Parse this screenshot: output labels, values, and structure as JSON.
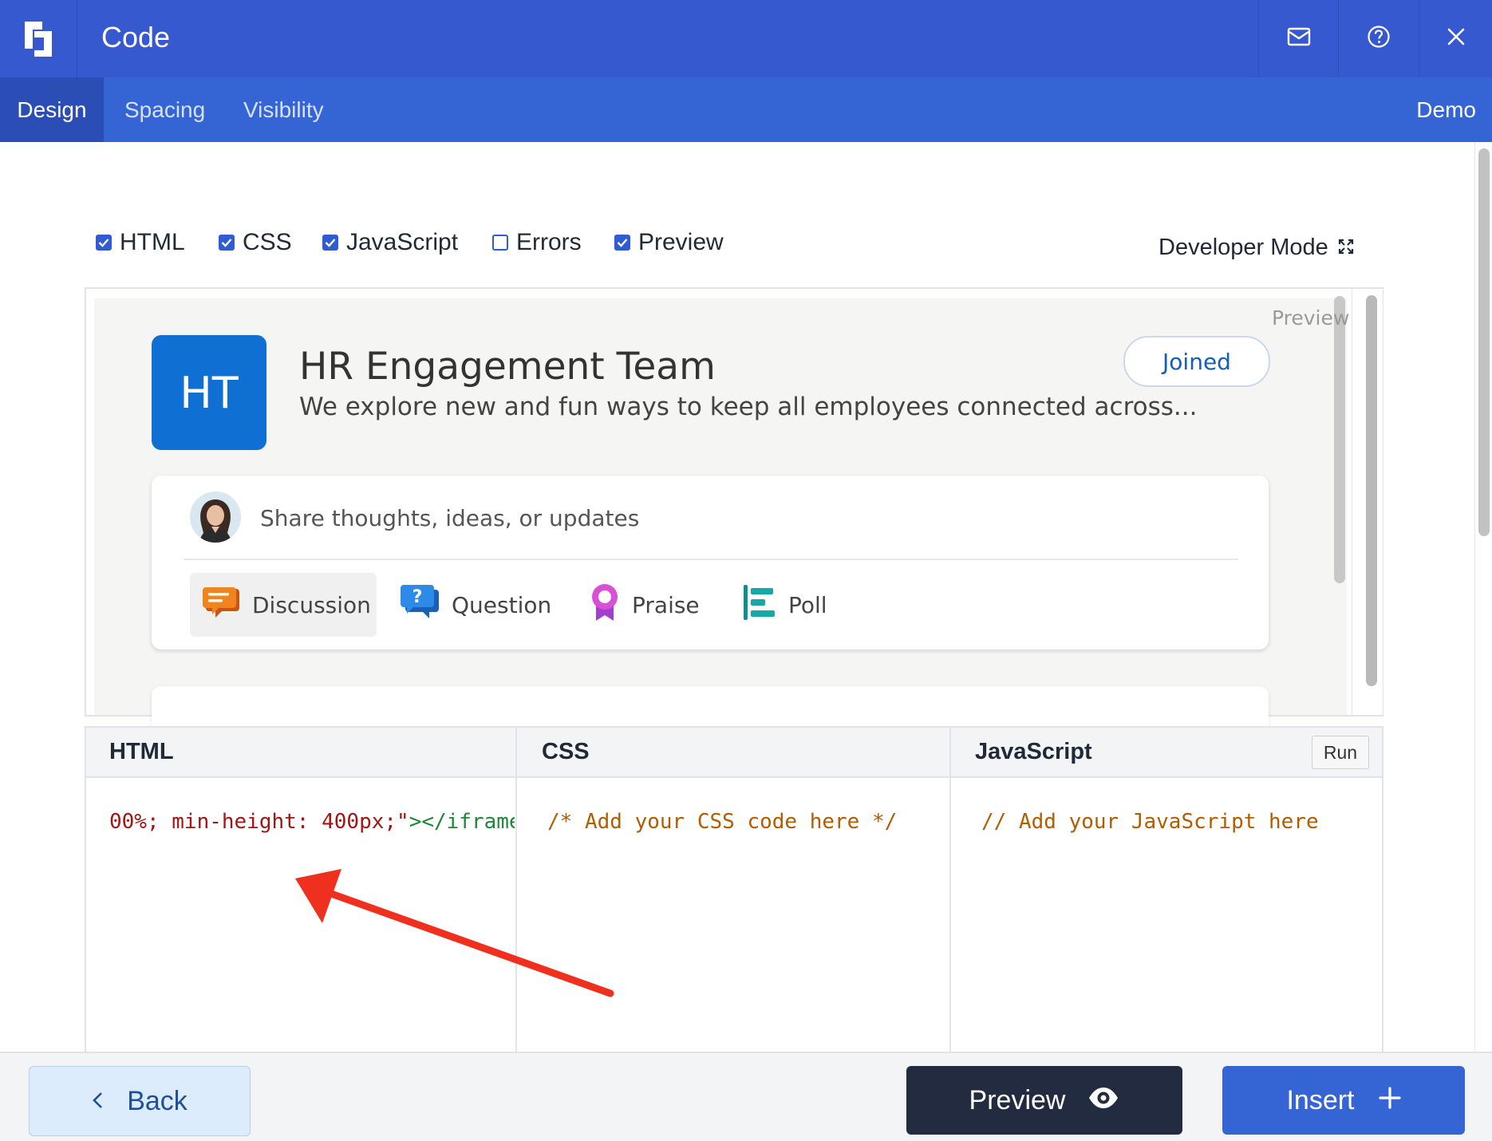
{
  "header": {
    "title": "Code",
    "logo_icon": "editor-logo-icon",
    "buttons": [
      {
        "icon": "mail-icon"
      },
      {
        "icon": "help-icon"
      },
      {
        "icon": "close-icon"
      }
    ]
  },
  "tabs": [
    {
      "label": "Design",
      "active": true
    },
    {
      "label": "Spacing",
      "active": false
    },
    {
      "label": "Visibility",
      "active": false
    }
  ],
  "demo_label": "Demo",
  "toggles": [
    {
      "label": "HTML",
      "checked": true
    },
    {
      "label": "CSS",
      "checked": true
    },
    {
      "label": "JavaScript",
      "checked": true
    },
    {
      "label": "Errors",
      "checked": false
    },
    {
      "label": "Preview",
      "checked": true
    }
  ],
  "developer_mode": {
    "label": "Developer Mode",
    "icon": "expand-icon"
  },
  "preview": {
    "tag": "Preview",
    "group": {
      "initials": "HT",
      "name": "HR Engagement Team",
      "description": "We explore new and fun ways to keep all employees connected across...",
      "join_status": "Joined"
    },
    "compose": {
      "placeholder": "Share thoughts, ideas, or updates",
      "post_types": [
        {
          "label": "Discussion",
          "icon": "discussion-icon",
          "active": true
        },
        {
          "label": "Question",
          "icon": "question-icon",
          "active": false
        },
        {
          "label": "Praise",
          "icon": "praise-icon",
          "active": false
        },
        {
          "label": "Poll",
          "icon": "poll-icon",
          "active": false
        }
      ]
    }
  },
  "editors": {
    "html": {
      "title": "HTML",
      "code_red": "00%; min-height: 400px;\"",
      "code_green": "></iframe"
    },
    "css": {
      "title": "CSS",
      "code": "/* Add your CSS code here */"
    },
    "js": {
      "title": "JavaScript",
      "code": "// Add your JavaScript here",
      "run_label": "Run"
    }
  },
  "footer": {
    "back_label": "Back",
    "preview_label": "Preview",
    "insert_label": "Insert"
  },
  "colors": {
    "header_bg": "#3659cf",
    "tabs_bg": "#3564d4",
    "active_tab_bg": "#2a4db6",
    "accent": "#2f5bd3",
    "group_tile": "#0f6fd3",
    "annotation_arrow": "#f0301e",
    "preview_button": "#222b40"
  }
}
